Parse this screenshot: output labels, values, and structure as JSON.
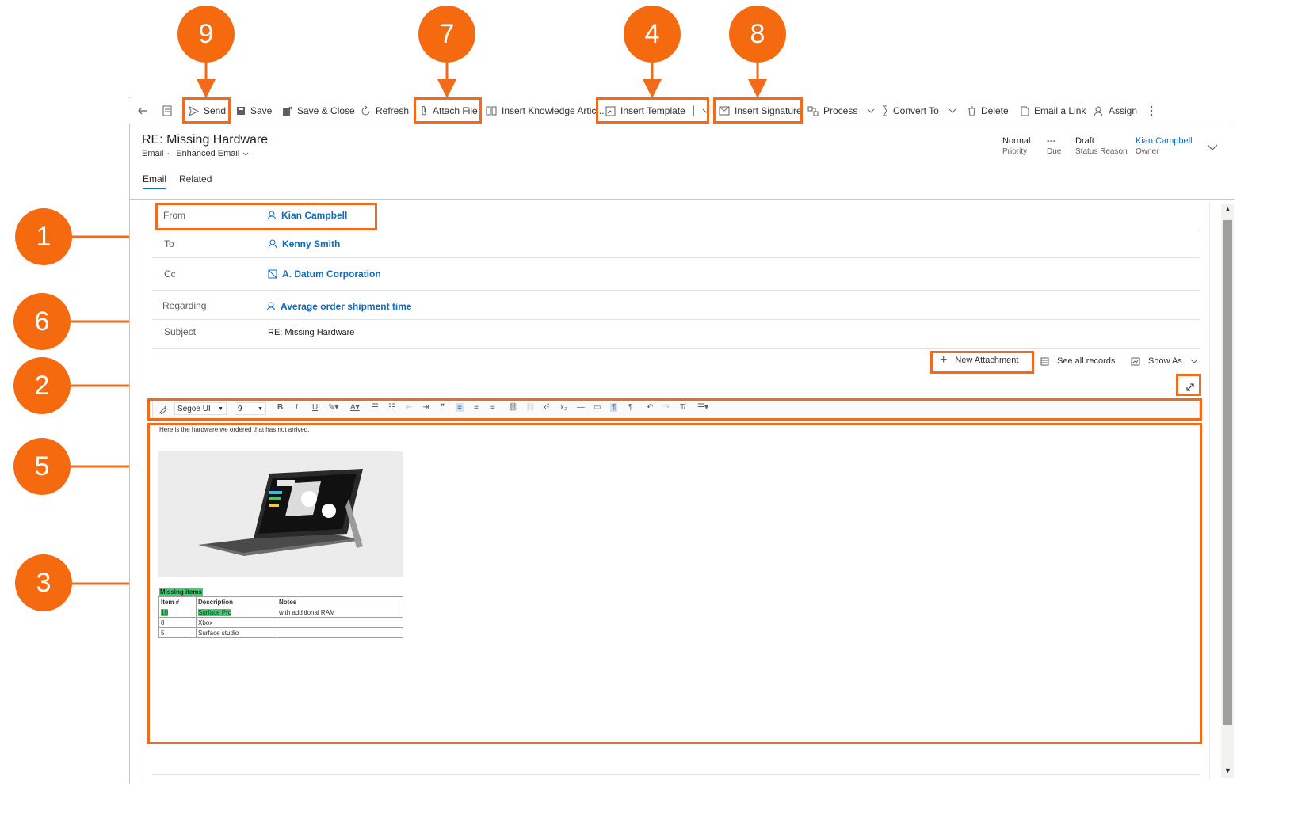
{
  "badges": [
    "9",
    "7",
    "4",
    "8",
    "1",
    "6",
    "2",
    "5",
    "3"
  ],
  "toolbar": {
    "send": "Send",
    "save": "Save",
    "save_close": "Save & Close",
    "refresh": "Refresh",
    "attach_file": "Attach File",
    "insert_knowledge": "Insert Knowledge Artic...",
    "insert_template": "Insert Template",
    "insert_signature": "Insert Signature",
    "process": "Process",
    "convert_to": "Convert To",
    "delete": "Delete",
    "email_link": "Email a Link",
    "assign": "Assign"
  },
  "header": {
    "title": "RE: Missing Hardware",
    "entity": "Email",
    "form": "Enhanced Email",
    "priority_value": "Normal",
    "priority_label": "Priority",
    "due_value": "---",
    "due_label": "Due",
    "status_value": "Draft",
    "status_label": "Status Reason",
    "owner_value": "Kian Campbell",
    "owner_label": "Owner"
  },
  "tabs": [
    "Email",
    "Related"
  ],
  "fields": {
    "from_label": "From",
    "from_value": "Kian Campbell",
    "to_label": "To",
    "to_value": "Kenny Smith",
    "cc_label": "Cc",
    "cc_value": "A. Datum Corporation",
    "regarding_label": "Regarding",
    "regarding_value": "Average order shipment time",
    "subject_label": "Subject",
    "subject_value": "RE: Missing Hardware"
  },
  "attachments": {
    "new_attachment": "New Attachment",
    "see_all": "See all records",
    "show_as": "Show As"
  },
  "editor": {
    "font": "Segoe UI",
    "size": "9",
    "body_text": "Here is the hardware we ordered that has not arrived.",
    "table_title": "Missing items",
    "columns": [
      "Item #",
      "Description",
      "Notes"
    ],
    "rows": [
      [
        "10",
        "Surface Pro",
        "with additional RAM"
      ],
      [
        "8",
        "Xbox",
        ""
      ],
      [
        "5",
        "Surface studio",
        ""
      ]
    ]
  },
  "colors": {
    "accent": "#f5690f",
    "link": "#0f6cbd",
    "highlight": "#3cd070"
  }
}
